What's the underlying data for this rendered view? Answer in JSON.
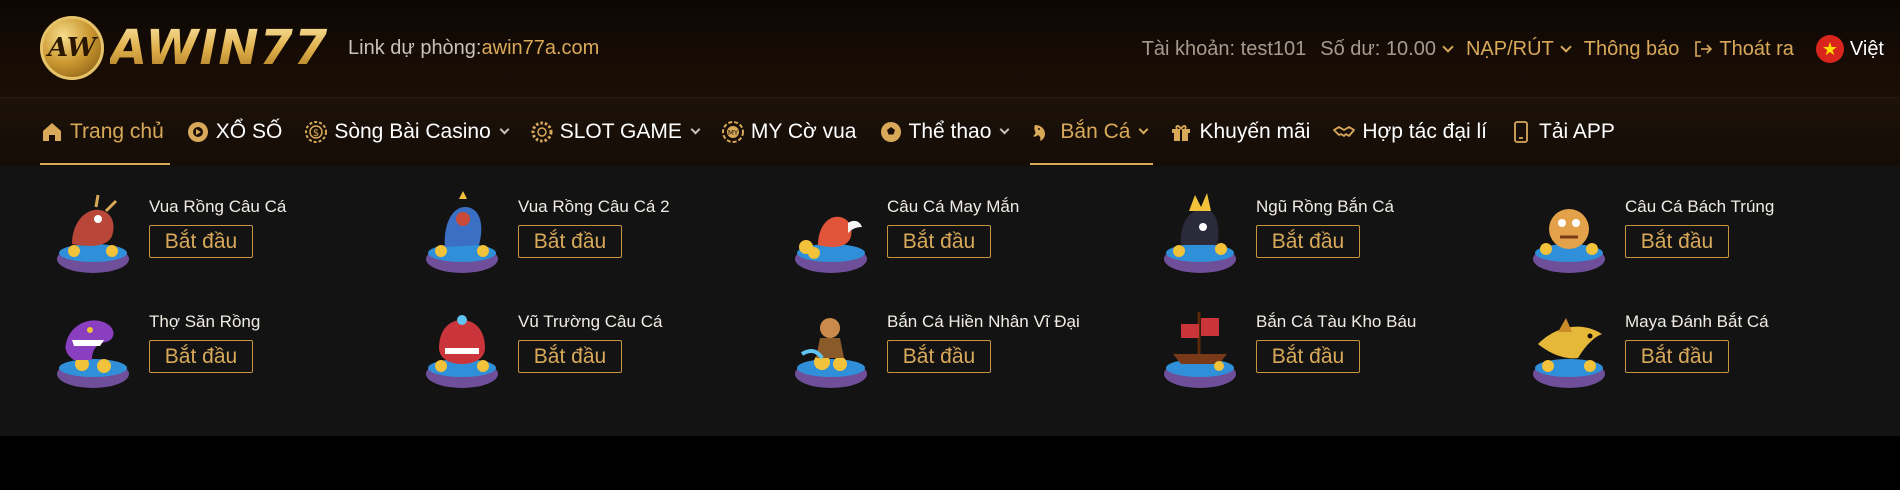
{
  "header": {
    "logo_badge": "AW",
    "logo_text": "AWIN77",
    "backup_label": "Link dự phòng:",
    "backup_url": "awin77a.com",
    "account_label": "Tài khoản: test101",
    "balance_label": "Số dư: 10.00",
    "deposit_label": "NẠP/RÚT",
    "notice_label": "Thông báo",
    "logout_label": "Thoát ra",
    "language": "Việt",
    "flag_star": "★"
  },
  "nav": [
    {
      "label": "Trang chủ",
      "icon": "home-icon"
    },
    {
      "label": "XỔ SỐ",
      "icon": "lottery-icon"
    },
    {
      "label": "Sòng Bài Casino",
      "icon": "casino-chip-icon"
    },
    {
      "label": "SLOT GAME",
      "icon": "slot-gear-icon"
    },
    {
      "label": "MY Cờ vua",
      "icon": "chess-icon"
    },
    {
      "label": "Thể thao",
      "icon": "soccer-ball-icon"
    },
    {
      "label": "Bắn Cá",
      "icon": "fish-icon"
    },
    {
      "label": "Khuyến mãi",
      "icon": "gift-icon"
    },
    {
      "label": "Hợp tác đại lí",
      "icon": "handshake-icon"
    },
    {
      "label": "Tải APP",
      "icon": "phone-icon"
    }
  ],
  "games": [
    {
      "title": "Vua Rồng Câu Cá",
      "button": "Bắt đầu"
    },
    {
      "title": "Vua Rồng Câu Cá 2",
      "button": "Bắt đầu"
    },
    {
      "title": "Câu Cá May Mắn",
      "button": "Bắt đầu"
    },
    {
      "title": "Ngũ Rồng Bắn Cá",
      "button": "Bắt đầu"
    },
    {
      "title": "Câu Cá Bách Trúng",
      "button": "Bắt đầu"
    },
    {
      "title": "Thợ Săn Rồng",
      "button": "Bắt đầu"
    },
    {
      "title": "Vũ Trường Câu Cá",
      "button": "Bắt đầu"
    },
    {
      "title": "Bắn Cá Hiền Nhân Vĩ Đại",
      "button": "Bắt đầu"
    },
    {
      "title": "Bắn Cá Tàu Kho Báu",
      "button": "Bắt đầu"
    },
    {
      "title": "Maya Đánh Bắt Cá",
      "button": "Bắt đầu"
    }
  ],
  "colors": {
    "accent_gold": "#d9a95a",
    "panel_bg": "#131313",
    "header_bg": "#170c05"
  }
}
